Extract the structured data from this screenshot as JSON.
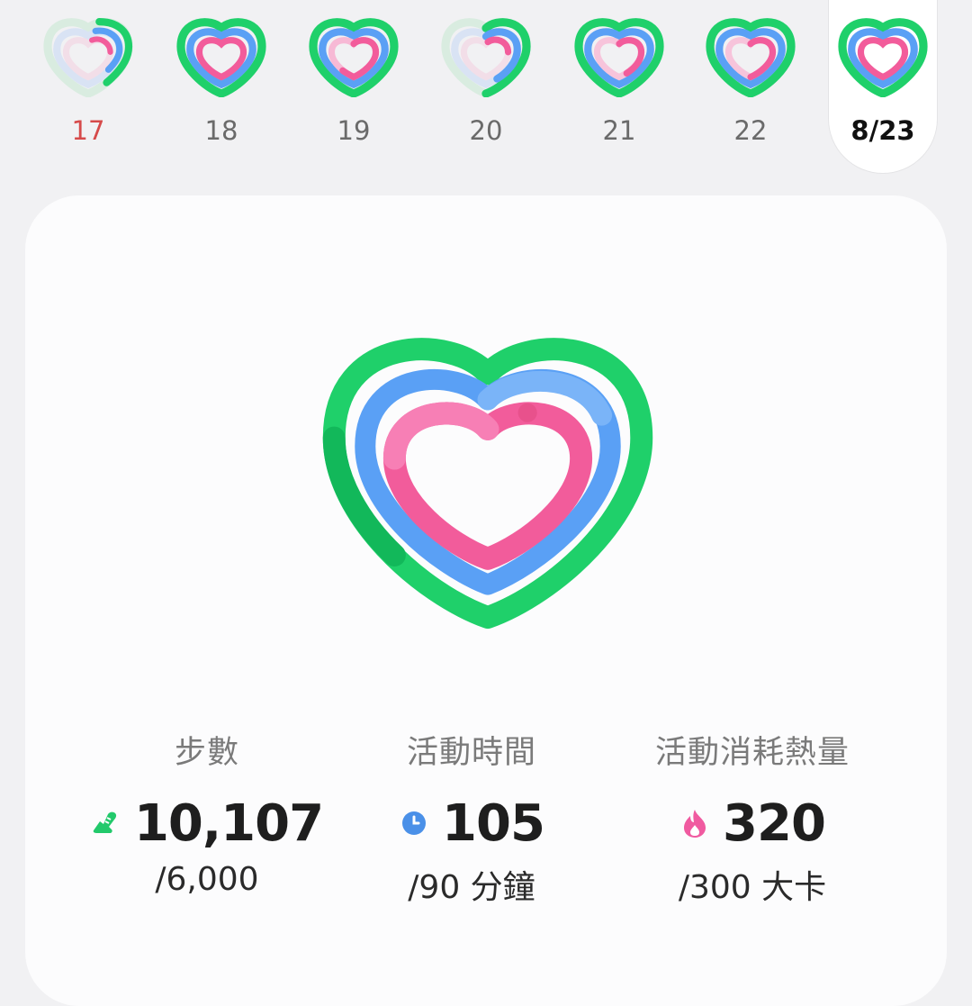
{
  "days": [
    {
      "label": "17",
      "weekend": true,
      "today": false,
      "faded": true
    },
    {
      "label": "18",
      "weekend": false,
      "today": false,
      "faded": false
    },
    {
      "label": "19",
      "weekend": false,
      "today": false,
      "faded": false
    },
    {
      "label": "20",
      "weekend": false,
      "today": false,
      "faded": true
    },
    {
      "label": "21",
      "weekend": false,
      "today": false,
      "faded": false
    },
    {
      "label": "22",
      "weekend": false,
      "today": false,
      "faded": false
    },
    {
      "label": "8/23",
      "weekend": false,
      "today": true,
      "faded": false
    }
  ],
  "stats": {
    "steps": {
      "title": "步數",
      "value": "10,107",
      "goal": "/6,000",
      "icon": "shoe-icon",
      "color": "#22c96b"
    },
    "active_time": {
      "title": "活動時間",
      "value": "105",
      "goal": "/90 分鐘",
      "icon": "clock-icon",
      "color": "#4a90e8"
    },
    "calories": {
      "title": "活動消耗熱量",
      "value": "320",
      "goal": "/300 大卡",
      "icon": "flame-icon",
      "color": "#f05aa0"
    }
  },
  "colors": {
    "green": "#1fd06a",
    "blue": "#5aa0f5",
    "pink": "#f25c9b",
    "background": "#f1f1f3",
    "card": "#fcfcfd"
  }
}
